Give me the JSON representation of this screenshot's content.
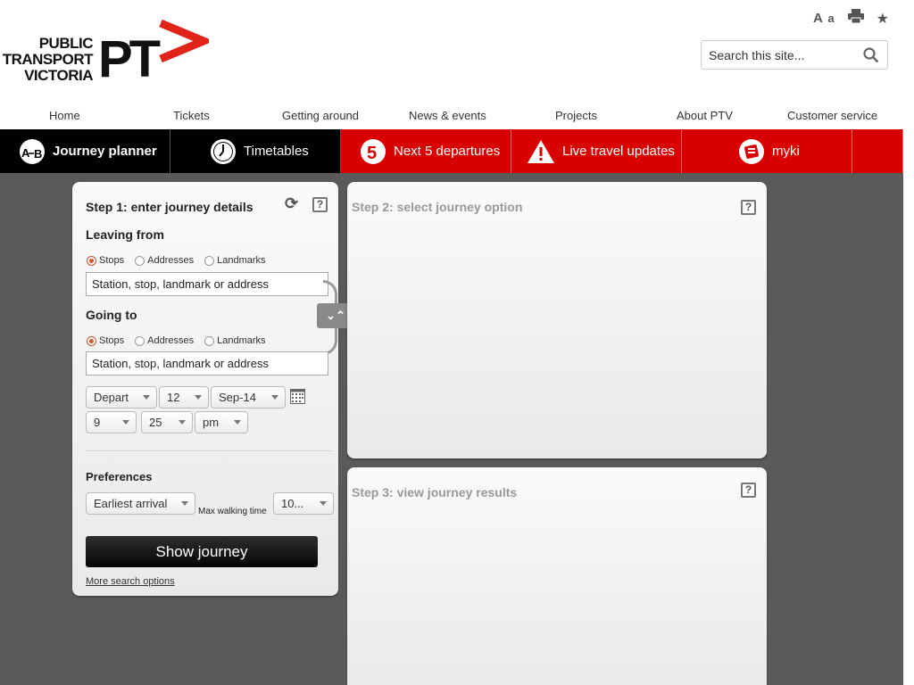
{
  "logo": {
    "line1": "PUBLIC",
    "line2": "TRANSPORT",
    "line3": "VICTORIA",
    "mark": "PT"
  },
  "utility": {
    "text_size_large": "A",
    "text_size_small": "a"
  },
  "search": {
    "placeholder": "Search this site..."
  },
  "topnav": [
    "Home",
    "Tickets",
    "Getting around",
    "News & events",
    "Projects",
    "About PTV",
    "Customer service"
  ],
  "tabs": [
    {
      "label": "Journey planner",
      "icon": "journey-ab-icon"
    },
    {
      "label": "Timetables",
      "icon": "clock-icon"
    },
    {
      "label": "Next 5 departures",
      "icon": "five-icon"
    },
    {
      "label": "Live travel updates",
      "icon": "warning-icon"
    },
    {
      "label": "myki",
      "icon": "myki-card-icon"
    }
  ],
  "step1": {
    "title": "Step 1: enter journey details",
    "help": "?",
    "leaving_from": {
      "label": "Leaving from",
      "options": [
        "Stops",
        "Addresses",
        "Landmarks"
      ],
      "selected": "Stops",
      "input": "Station, stop, landmark or address"
    },
    "going_to": {
      "label": "Going to",
      "options": [
        "Stops",
        "Addresses",
        "Landmarks"
      ],
      "selected": "Stops",
      "input": "Station, stop, landmark or address"
    },
    "when": {
      "mode": "Depart",
      "day": "12",
      "month": "Sep-14",
      "hour": "9",
      "minute": "25",
      "ampm": "pm"
    },
    "preferences": {
      "label": "Preferences",
      "sort": "Earliest arrival",
      "walk_label": "Max walking time",
      "walk_value": "10..."
    },
    "show_button": "Show journey",
    "more_link": "More search options"
  },
  "step2": {
    "title": "Step 2: select journey option",
    "help": "?"
  },
  "step3": {
    "title": "Step 3: view journey results",
    "help": "?"
  },
  "colors": {
    "brand_red": "#d90000",
    "tab_black": "#000000",
    "background": "#5a5a5a",
    "logo_red": "#e2231a"
  }
}
